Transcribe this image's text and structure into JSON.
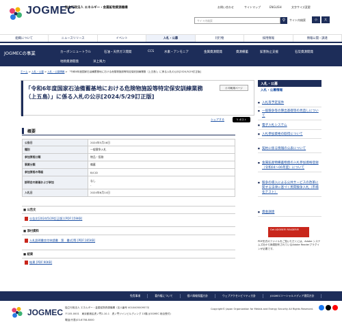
{
  "header": {
    "logo": "JOGMEC",
    "org_name": "独立行政法人 エネルギー・金属鉱物資源機構",
    "util_links": [
      "お問い合わせ",
      "サイトマップ",
      "ENGLISH"
    ],
    "font_size_label": "文字サイズ変更",
    "font_small": "小",
    "font_large": "大",
    "search_placeholder": "サイト内検索",
    "site_search_label": "サイト内検索"
  },
  "gnav": [
    "組織について",
    "ニュースリリース",
    "イベント",
    "入札・公募",
    "刊行物",
    "採用情報",
    "情報公開・調達"
  ],
  "bnav": {
    "title": "JOGMECの事業",
    "row1": [
      "カーボンニュートラル",
      "石油・天然ガス開発",
      "CCS",
      "水素・アンモニア",
      "金属資源開発",
      "資源備蓄",
      "鉱害防止支援",
      "石炭資源開発"
    ],
    "row2": [
      "地熱資源開発",
      "洋上風力"
    ]
  },
  "breadcrumb": [
    "ホーム",
    "入札・公募",
    "入札・公募情報",
    "「令和6年度国家石油備蓄基地における危険物施設等特定保安訓練業務（上五島）」に係る入札の公示[2024/5/29訂正版]"
  ],
  "main": {
    "title": "「令和6年度国家石油備蓄基地における危険物施設等特定保安訓練業務（上五島）」に係る入札の公示[2024/5/29訂正版]",
    "print_label": "印刷用ページ",
    "share_label": "シェアする",
    "tweet_label": "ポスト",
    "overview_head": "概要",
    "table": [
      {
        "k": "公告日",
        "v": "2024年5月16日"
      },
      {
        "k": "種別",
        "v": "一般競争入札"
      },
      {
        "k": "参加資格分類",
        "v": "物品・役務"
      },
      {
        "k": "事業分類",
        "v": "備蓄"
      },
      {
        "k": "参加資格の等級",
        "v": "B/C/D"
      },
      {
        "k": "説明会の開催および参加",
        "v": "なし\n-"
      },
      {
        "k": "入札日",
        "v": "2024年6月14日"
      }
    ],
    "blocks": [
      {
        "head": "公告文",
        "link": "公告文[2024/5/29訂正版] [PDF:159KB]"
      },
      {
        "head": "添付資料",
        "link": "入札説明書交付申請書　第　書式]等 [PDF:165KB]"
      },
      {
        "head": "結果",
        "link": "結果 [PDF:90KB]"
      }
    ]
  },
  "side": {
    "head": "入札・公募",
    "sub": "入札・公募情報",
    "items": [
      "入札等予定案件",
      "一般競争等の算出基礎等の見直しについて",
      "電子入札システム",
      "入札参加資格の取得について",
      "契約に係る情報の公表について",
      "金属鉱産物備蓄物資の入札参加資格登録（令和04～06年度）について",
      "競争の導入による公共サービスの改革に関する法律に基づく民間競争入札（市場化テスト）",
      "資金調達"
    ],
    "adobe_label": "Get ADOBE® READER®",
    "adobe_text": "PDF形式のファイルをご覧いただくには、Adobe システムズ社から無償配布されているAdobe Readerプラグインが必要です。"
  },
  "footer": {
    "links": [
      "免責事項",
      "著作権について",
      "個人情報保護方針",
      "ウェブアクセシビリティ方針",
      "JOGMECソーシャルメディア運用方針"
    ],
    "logo": "JOGMEC",
    "org": "独立行政法人 エネルギー・金属鉱物資源機構（法人番号 4010405009573）",
    "addr": "〒105-0001　東京都港区虎ノ門2-10-1　虎ノ門ツインビルディング 15階 (JOGMEC 総合受付)",
    "tel": "電話(代表)03-6758-8000",
    "copyright": "Copyright© Japan Organization for Metals and Energy Security All Rights Reserved.",
    "colors": {
      "navy": "#1d2d59",
      "link": "#1a4fa3"
    }
  }
}
